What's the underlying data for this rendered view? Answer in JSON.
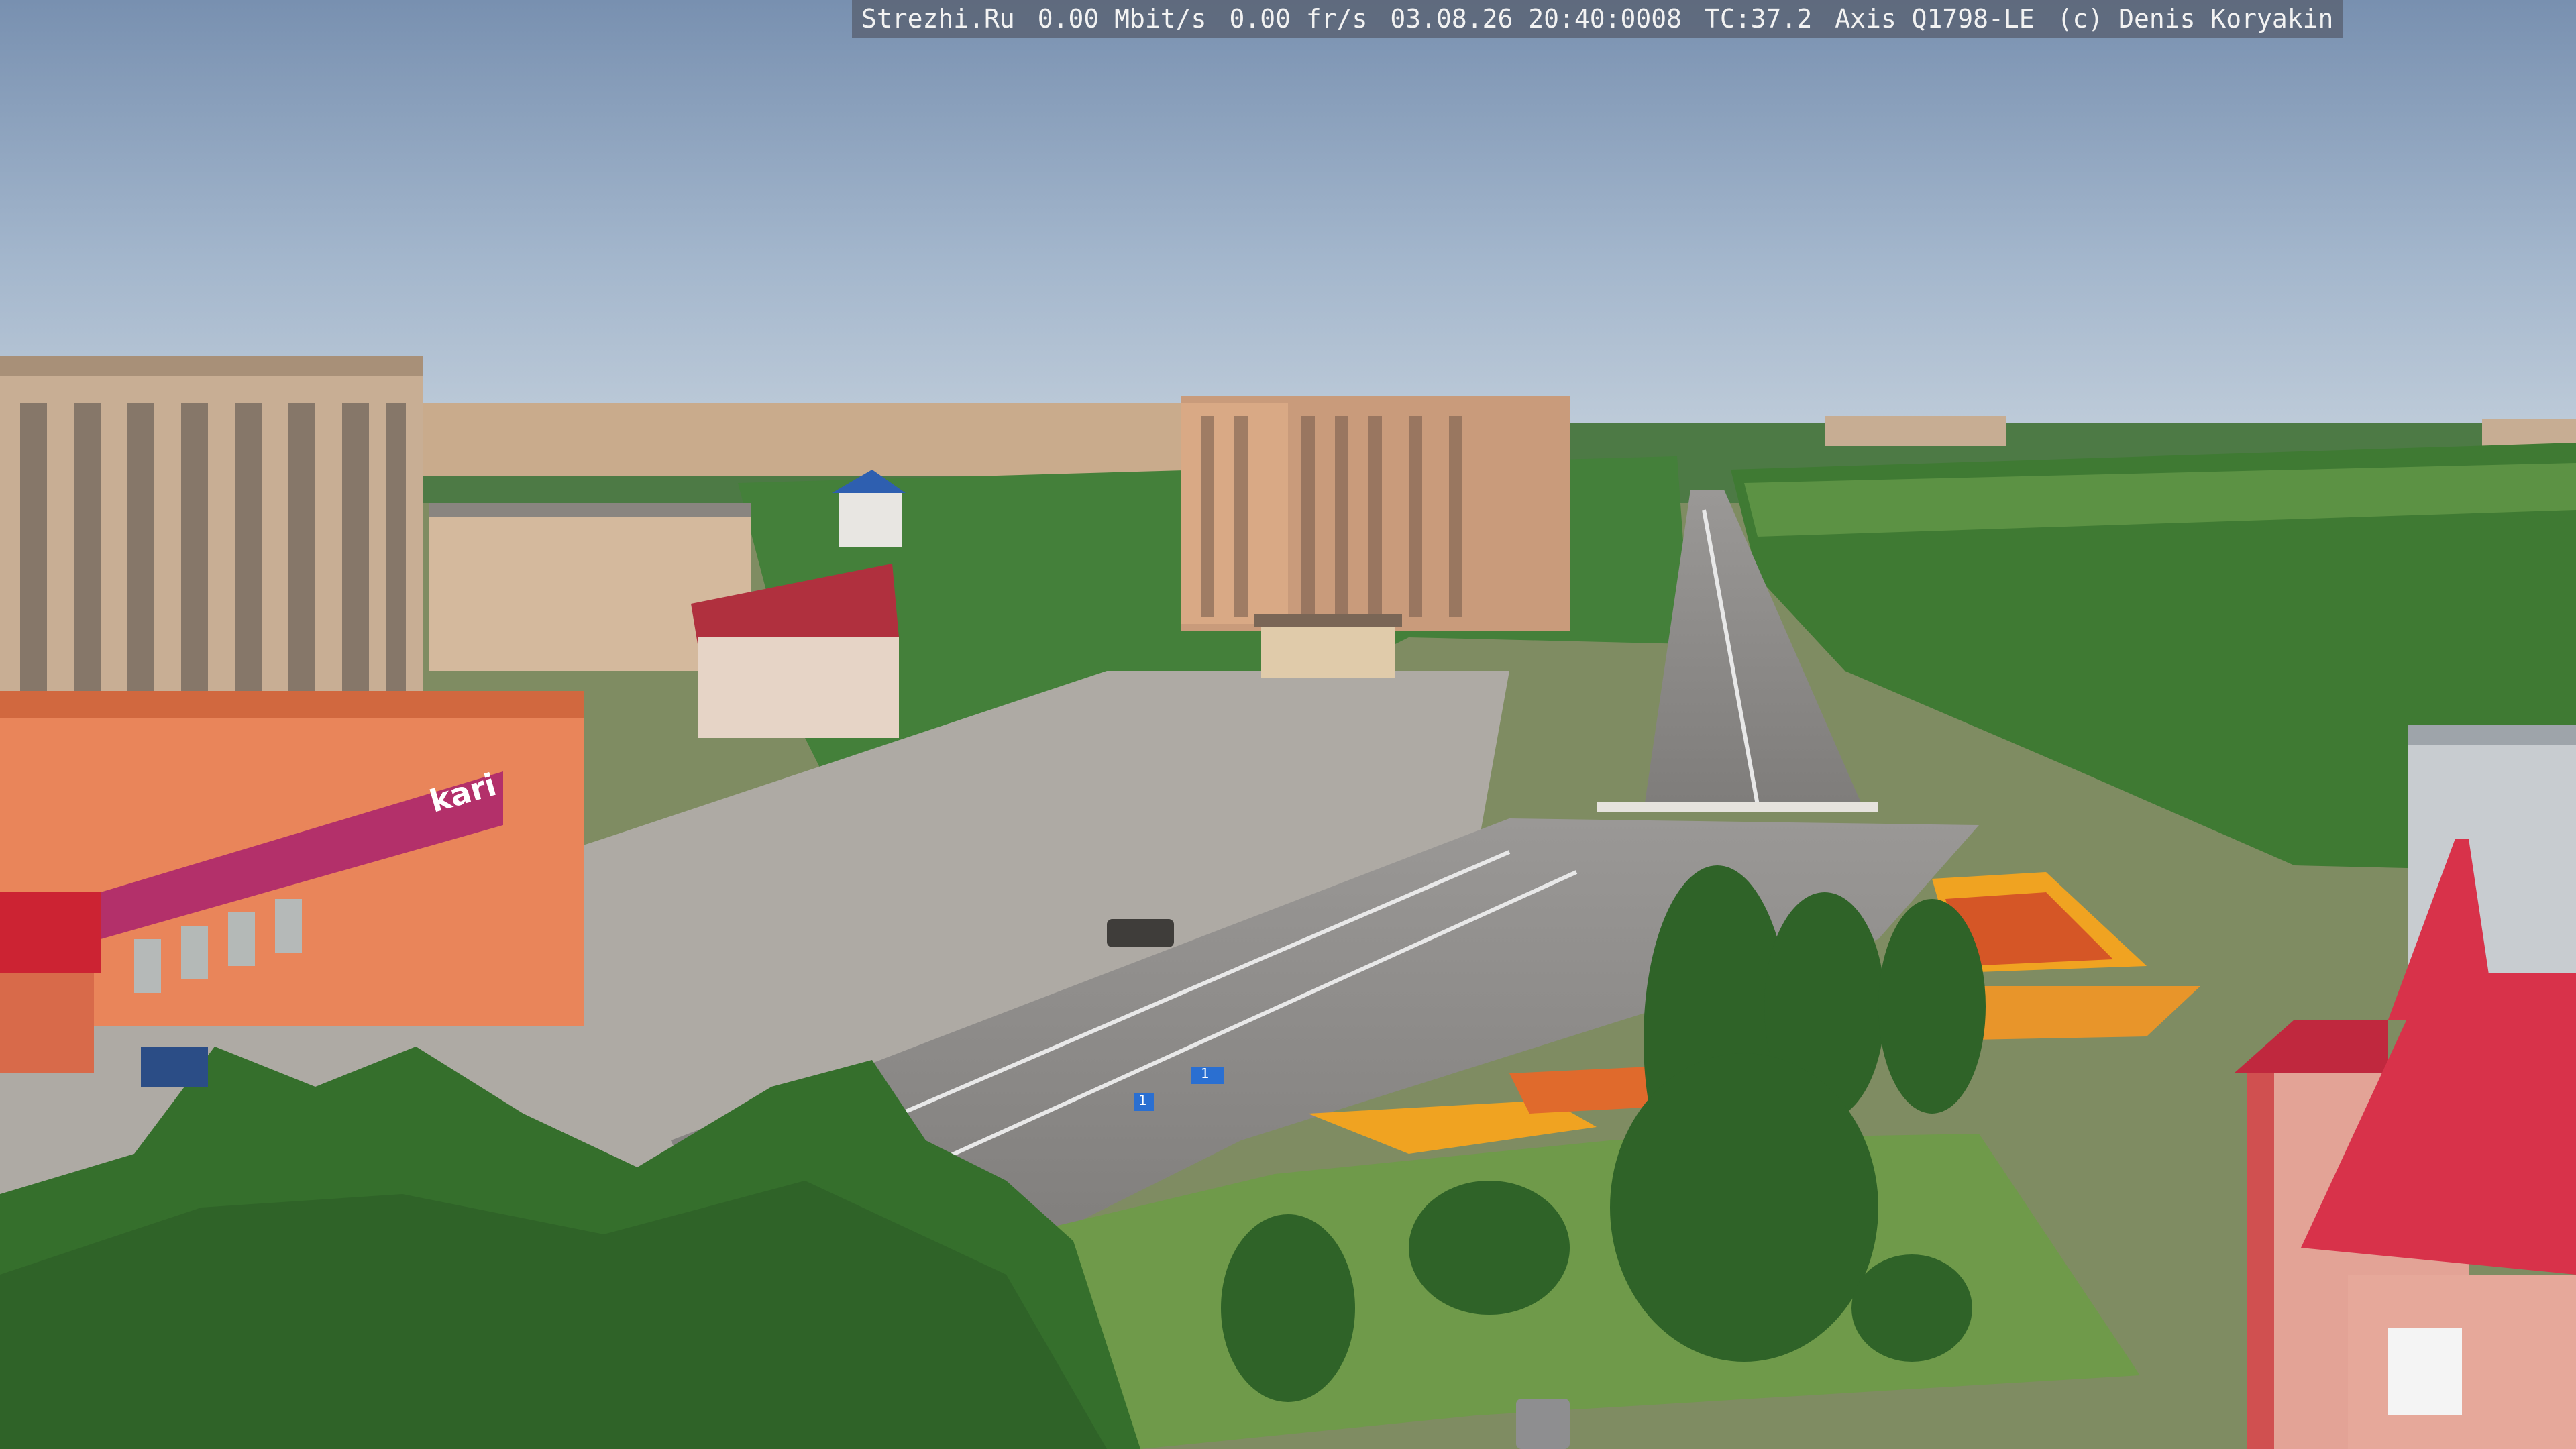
{
  "overlay": {
    "site": "Strezhi.Ru",
    "bitrate": "0.00 Mbit/s",
    "framerate": "0.00 fr/s",
    "datetime": "03.08.26 20:40:0008",
    "tc": "TC:37.2",
    "camera": "Axis Q1798-LE",
    "credit": "(c) Denis Koryakin"
  },
  "signs": {
    "store_brand": "kari",
    "road_sign_1": "1",
    "road_sign_2": "1"
  },
  "colors": {
    "sky_top": "#7f97b6",
    "sky_bottom": "#b9c9d9",
    "foliage": "#3f7a33",
    "asphalt": "#8d8b88",
    "store_magenta": "#b3306a",
    "roof_red": "#d8324a"
  }
}
